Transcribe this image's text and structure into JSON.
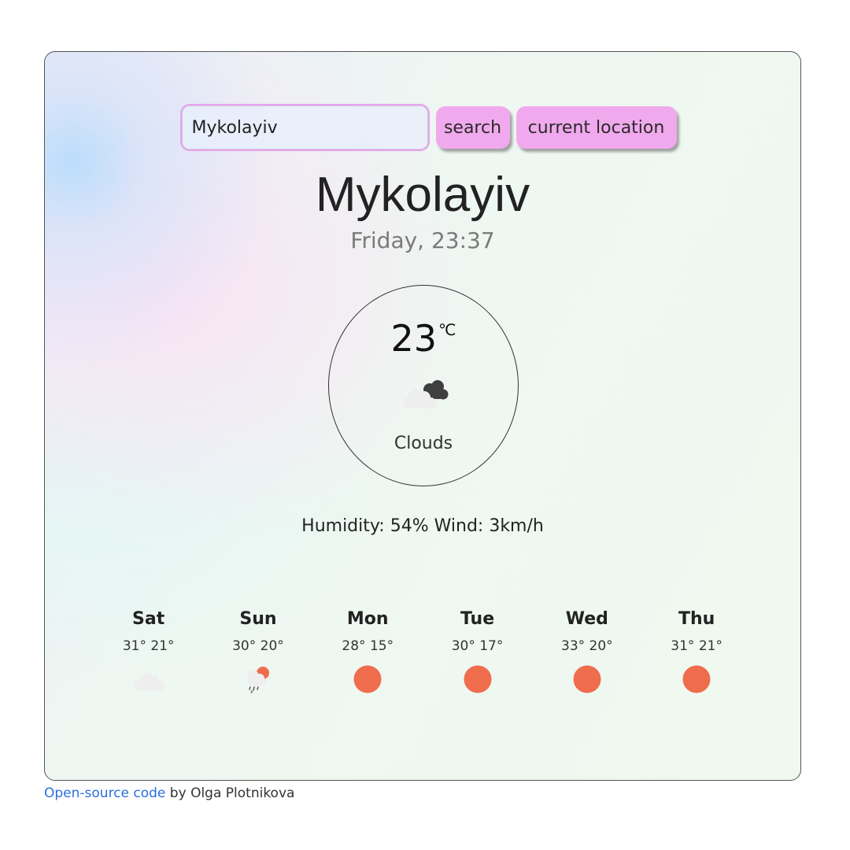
{
  "search": {
    "value": "Mykolayiv",
    "search_label": "search",
    "location_label": "current location"
  },
  "current": {
    "city": "Mykolayiv",
    "datetime": "Friday, 23:37",
    "temperature": "23",
    "unit": "℃",
    "description": "Clouds",
    "icon": "broken-clouds-icon",
    "humidity_label": "Humidity: 54%",
    "wind_label": "Wind: 3km/h"
  },
  "forecast": [
    {
      "day": "Sat",
      "temps": "31° 21°",
      "icon": "cloud-icon"
    },
    {
      "day": "Sun",
      "temps": "30° 20°",
      "icon": "sun-rain-icon"
    },
    {
      "day": "Mon",
      "temps": "28° 15°",
      "icon": "sun-icon"
    },
    {
      "day": "Tue",
      "temps": "30° 17°",
      "icon": "sun-icon"
    },
    {
      "day": "Wed",
      "temps": "33° 20°",
      "icon": "sun-icon"
    },
    {
      "day": "Thu",
      "temps": "31° 21°",
      "icon": "sun-icon"
    }
  ],
  "footer": {
    "link_text": "Open-source code",
    "by_text": " by Olga Plotnikova"
  },
  "colors": {
    "button": "#f1a9ee",
    "sun": "#ef6d4d",
    "input_border": "#e8a4ec"
  }
}
